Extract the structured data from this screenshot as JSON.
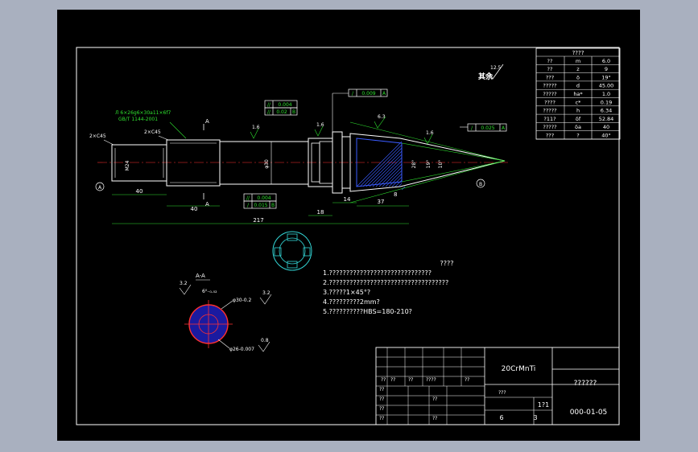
{
  "roughness": {
    "symbol": "12.5",
    "label": "其余"
  },
  "gear_table": {
    "title": "????",
    "rows": [
      [
        "??",
        "m",
        "6.0"
      ],
      [
        "??",
        "z",
        "9"
      ],
      [
        "???",
        "δ",
        "19°"
      ],
      [
        "?????",
        "d",
        "45.00"
      ],
      [
        "?????",
        "ha*",
        "1.0"
      ],
      [
        "????",
        "c*",
        "0.19"
      ],
      [
        "?????",
        "h",
        "6.34"
      ],
      [
        "?11?",
        "δf",
        "52.84"
      ],
      [
        "?????",
        "δa",
        "40"
      ],
      [
        "???",
        "?",
        "40°"
      ]
    ]
  },
  "callouts": {
    "spline_spec_1": "Л 6×26g6×30a11×6f7",
    "spline_spec_2": "GB/T 1144-2001",
    "chamfer_left": "2×C45",
    "chamfer_mid": "2×C45",
    "section_a_top": "A",
    "section_a_bottom": "A",
    "datum_a": "A",
    "datum_b": "B",
    "section_view_label": "A-A"
  },
  "tolerances": {
    "tol_a_sym": "//",
    "tol_a_val": "0.004",
    "tol_b_sym": "//",
    "tol_b_val": "0.02",
    "tol_b_ref": "B",
    "tol_c_sym": "//",
    "tol_c_val": "0.004",
    "tol_d_sym": "/",
    "tol_d_val": "0.015",
    "tol_d_ref": "B",
    "tol_e_sym": "/",
    "tol_e_val": "0.009",
    "tol_e_ref": "A",
    "tol_f_sym": "/",
    "tol_f_val": "0.025",
    "tol_f_ref": "A"
  },
  "dimensions": {
    "d40a": "40",
    "d40b": "40",
    "d217": "217",
    "d18": "18",
    "d14": "14",
    "d37": "37",
    "d8": "8",
    "r16a": "1.6",
    "r16b": "1.6",
    "r16c": "1.6",
    "r63": "6.3",
    "dia_shaft": "φ30",
    "dia_left": "M24",
    "ang_1": "28°",
    "ang_2": "19°",
    "ang_3": "10°"
  },
  "section_view": {
    "r32a": "3.2",
    "r32b": "3.2",
    "r08": "0.8",
    "spline_width": "6⁰₋₀.₀₂",
    "dia_outer": "φ30-0.2",
    "dia_inner": "φ26-0.007"
  },
  "notes": {
    "heading": "????",
    "items": [
      "1.??????????????????????????????",
      "2.???????????????????????????????????",
      "3.?????1×45°?",
      "4.?????????2mm?",
      "5.??????????HBS=180-210?"
    ]
  },
  "title_block": {
    "material": "20CrMnTi",
    "part_name": "??????",
    "drawing_no": "000-01-05",
    "scale_label": "???",
    "scale_value": "1?1",
    "sheets": "6",
    "sheet_no": "3",
    "row_labels": [
      "??",
      "??",
      "??",
      "????",
      "??"
    ],
    "left_labels": [
      "??",
      "??",
      "??",
      "??",
      "??"
    ],
    "mid_labels": [
      "??",
      "??"
    ]
  },
  "colors": {
    "background": "#000000",
    "outline": "#ffffff",
    "dimension": "#2fe22f",
    "hatch": "#3a5bff",
    "centerline": "#ff3030",
    "text": "#ffffff",
    "dim_text": "#ffff40"
  }
}
